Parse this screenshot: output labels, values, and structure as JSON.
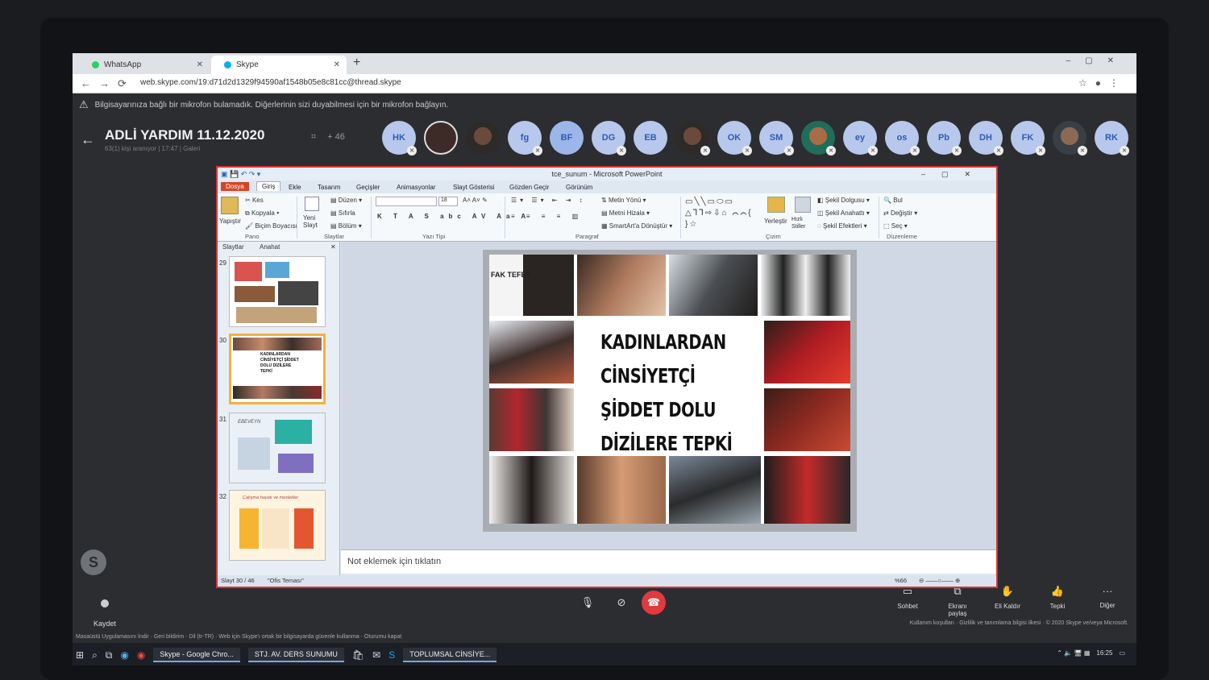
{
  "browser": {
    "tabs": [
      {
        "label": "WhatsApp"
      },
      {
        "label": "Skype"
      }
    ],
    "url": "web.skype.com/19:d71d2d1329f94590af1548b05e8c81cc@thread.skype"
  },
  "call": {
    "warning": "Bilgisayarınıza bağlı bir mikrofon bulamadık. Diğerlerinin sizi duyabilmesi için bir mikrofon bağlayın.",
    "title": "ADLİ YARDIM 11.12.2020",
    "subtitle": "63(1) kişi aranıyor | 17:47 | Galeri",
    "more_participants": "+ 46",
    "participants": [
      "HK",
      "",
      "",
      "fg",
      "BF",
      "DG",
      "EB",
      "",
      "OK",
      "SM",
      "",
      "ey",
      "os",
      "Pb",
      "DH",
      "FK",
      "",
      "RK"
    ]
  },
  "ppt": {
    "window_title": "tce_sunum - Microsoft PowerPoint",
    "tabs": [
      "Dosya",
      "Giriş",
      "Ekle",
      "Tasarım",
      "Geçişler",
      "Animasyonlar",
      "Slayt Gösterisi",
      "Gözden Geçir",
      "Görünüm"
    ],
    "ribbon": {
      "yapistir": "Yapıştır",
      "kes": "Kes",
      "kopyala": "Kopyala",
      "bicim": "Biçim Boyacısı",
      "pano": "Pano",
      "yeni_slayt": "Yeni Slayt",
      "duzen": "Düzen",
      "sifirla": "Sıfırla",
      "bolum": "Bölüm",
      "slaytlar": "Slaytlar",
      "font_size": "18",
      "yazi_tipi": "Yazı Tipi",
      "paragraf": "Paragraf",
      "metin_yonu": "Metin Yönü",
      "metni_hizala": "Metni Hizala",
      "smartart": "SmartArt'a Dönüştür",
      "cizim": "Çizim",
      "yerlestir": "Yerleştir",
      "hizli_stiller": "Hızlı Stiller",
      "sekil_dolgusu": "Şekil Dolgusu",
      "sekil_anahatti": "Şekil Anahattı",
      "sekil_efektleri": "Şekil Efektleri",
      "bul": "Bul",
      "degistir": "Değiştir",
      "sec": "Seç",
      "duzenleme": "Düzenleme"
    },
    "panel_tabs": [
      "Slaytlar",
      "Anahat"
    ],
    "thumbs": [
      {
        "num": "29",
        "text": ""
      },
      {
        "num": "30",
        "text": "KADINLARDAN CİNSİYETÇİ ŞİDDET DOLU DİZİLERE TEPKİ"
      },
      {
        "num": "31",
        "text": "EBEVEYN"
      },
      {
        "num": "32",
        "text": "Çalışma hayatı ve meslekler"
      }
    ],
    "slide_text": [
      "KADINLARDAN",
      "CİNSİYETÇİ",
      "ŞİDDET DOLU",
      "DİZİLERE TEPKİ"
    ],
    "notes_placeholder": "Not eklemek için tıklatın",
    "status_slide": "Slayt 30 / 46",
    "status_theme": "\"Ofis Teması\"",
    "zoom": "%66"
  },
  "controls": {
    "record": "Kaydet",
    "right": [
      "Sohbet",
      "Ekranı paylaş",
      "Eli Kaldır",
      "Tepki",
      "Diğer"
    ]
  },
  "footer": {
    "left": "Masaüstü Uygulamasını İndir  ·  Geri bildirim  ·  Dil (tr-TR)  ·  Web için Skype'ı ortak bir bilgisayarda güvenle kullanma  ·  Oturumu kapat",
    "right": "Kullanım koşulları  ·  Gizlilik ve tanımlama bilgisi ilkesi  ·  © 2020 Skype ve/veya Microsoft."
  },
  "taskbar": {
    "apps": [
      "Skype - Google Chro...",
      "STJ. AV. DERS SUNUMU",
      "TOPLUMSAL CİNSİYE..."
    ],
    "time": "16:25"
  }
}
